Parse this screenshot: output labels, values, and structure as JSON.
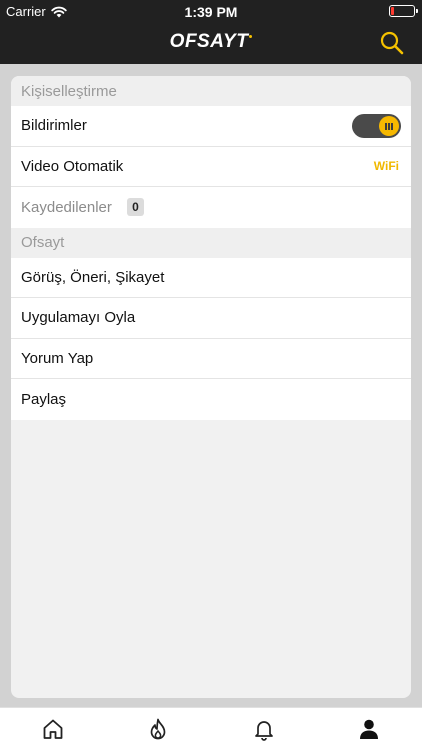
{
  "status_bar": {
    "carrier": "Carrier",
    "time": "1:39 PM"
  },
  "nav_bar": {
    "logo_text": "OFSAYT",
    "accent_color": "#f6c200"
  },
  "sections": [
    {
      "header": "Kişiselleştirme",
      "rows": [
        {
          "label": "Bildirimler",
          "control": "toggle",
          "toggle_on": true
        },
        {
          "label": "Video Otomatik",
          "value": "WiFi"
        },
        {
          "label": "Kaydedilenler",
          "badge": "0"
        }
      ]
    },
    {
      "header": "Ofsayt",
      "rows": [
        {
          "label": "Görüş, Öneri, Şikayet"
        },
        {
          "label": "Uygulamayı Oyla"
        },
        {
          "label": "Yorum Yap"
        },
        {
          "label": "Paylaş"
        }
      ]
    }
  ],
  "tab_bar": {
    "tabs": [
      {
        "icon": "home-icon",
        "selected": false
      },
      {
        "icon": "flame-icon",
        "selected": false
      },
      {
        "icon": "bell-icon",
        "selected": false
      },
      {
        "icon": "profile-icon",
        "selected": true
      }
    ]
  }
}
